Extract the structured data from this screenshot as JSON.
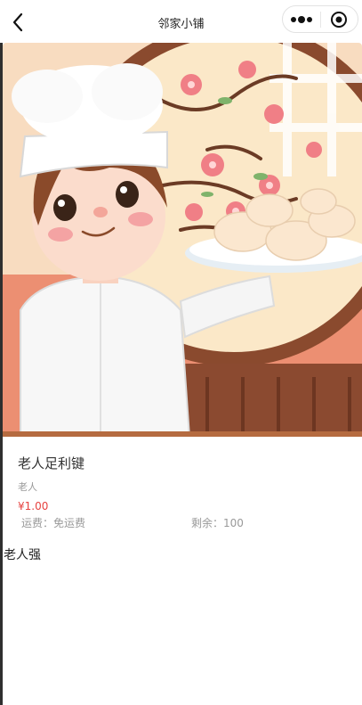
{
  "header": {
    "title": "邻家小铺",
    "back_icon": "chevron-left-icon",
    "more_icon": "more-dots-icon",
    "close_icon": "target-circle-icon"
  },
  "product": {
    "image_alt": "chef-holding-steamed-buns-illustration",
    "name": "老人足利键",
    "subtitle": "老人",
    "price": "¥1.00",
    "shipping": "运费：免运费",
    "stock": "剩余：100",
    "seller": "老人强"
  },
  "colors": {
    "price": "#e64340",
    "muted": "#999999",
    "hero_bg": "#f5d9b8"
  }
}
